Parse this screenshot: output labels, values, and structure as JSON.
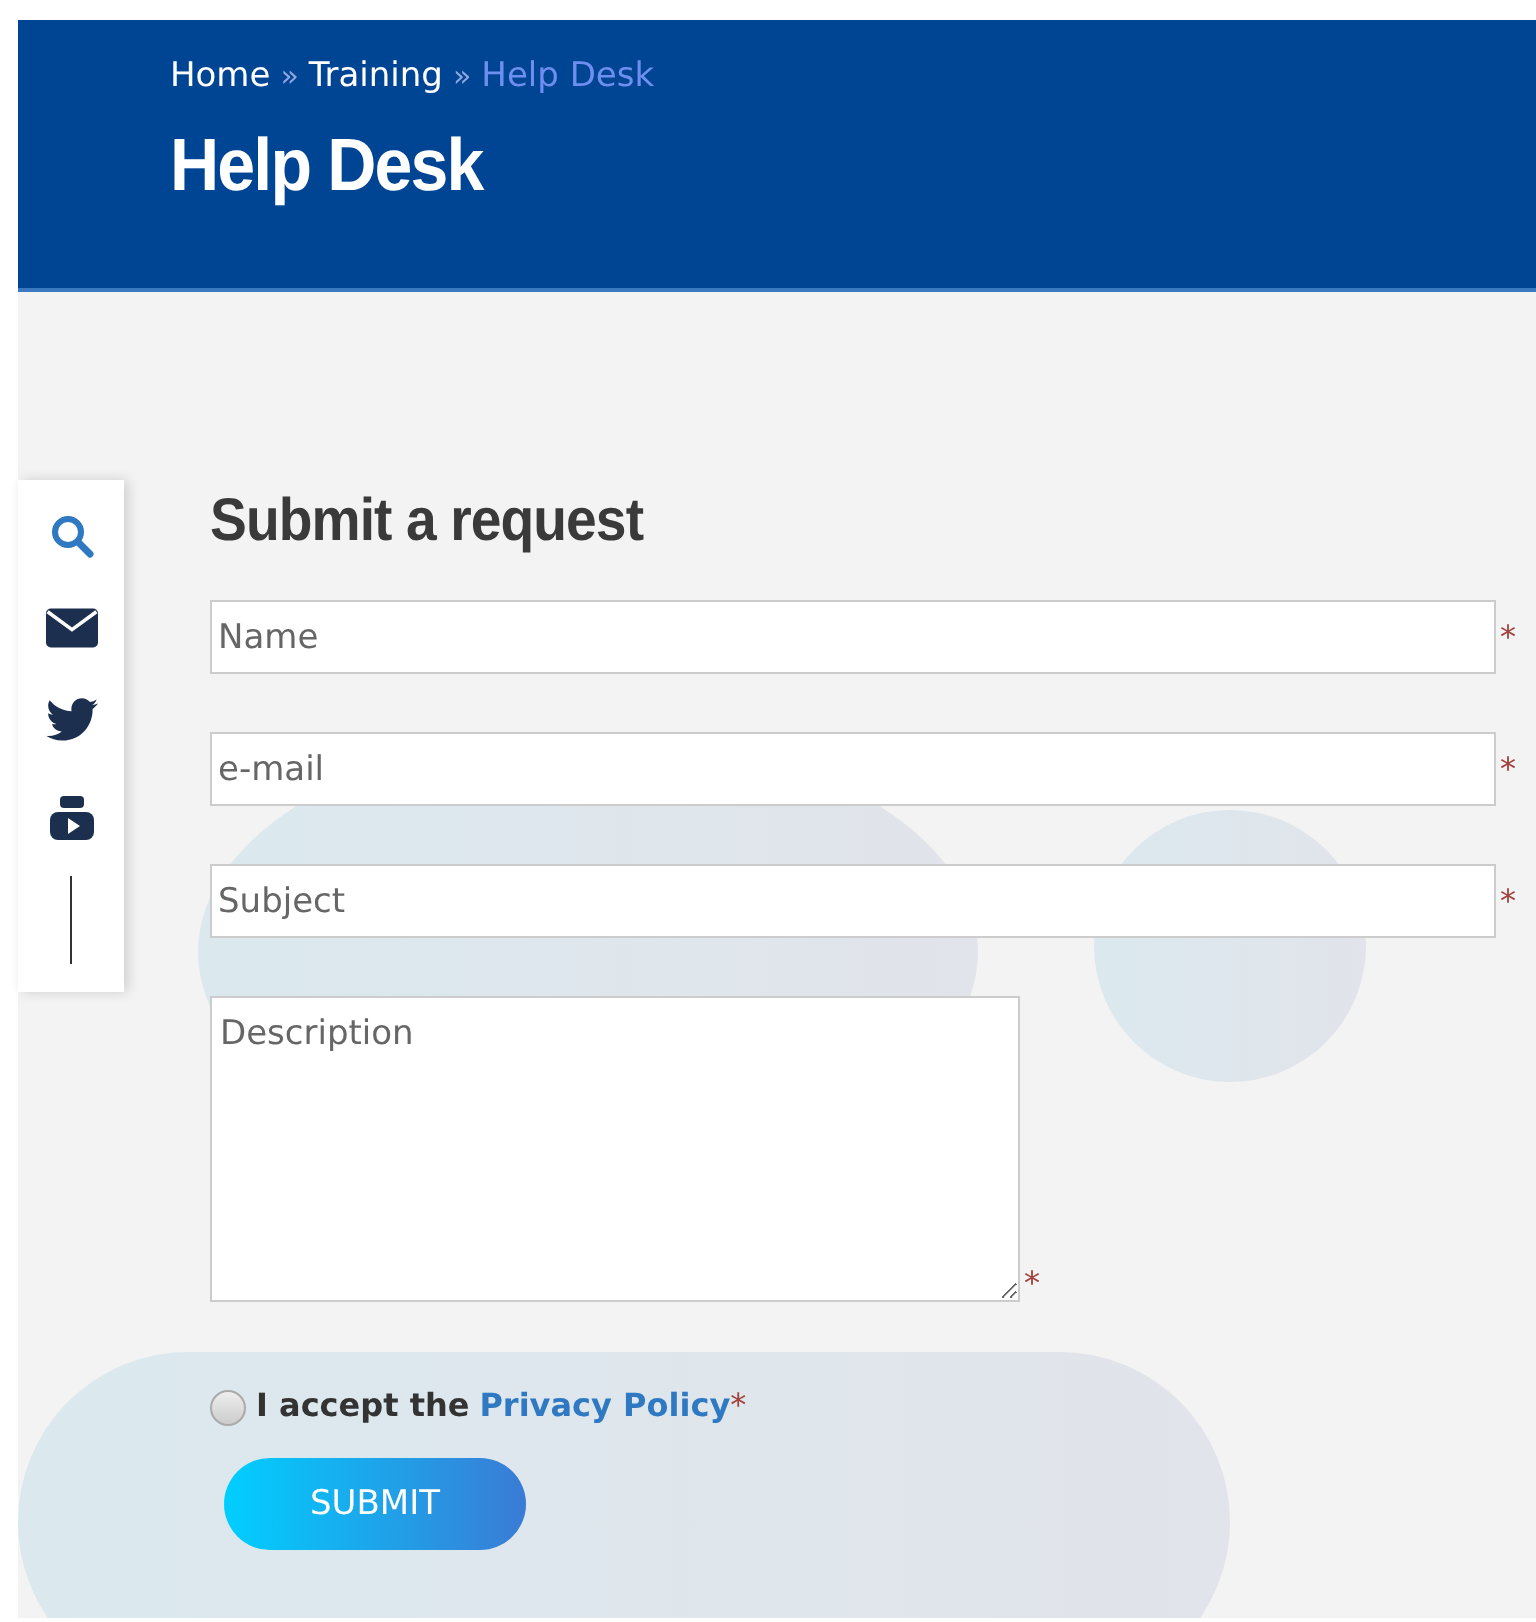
{
  "breadcrumb": [
    {
      "label": "Home",
      "current": false
    },
    {
      "label": "Training",
      "current": false
    },
    {
      "label": "Help Desk",
      "current": true
    }
  ],
  "breadcrumb_separator": "»",
  "page_title": "Help Desk",
  "social_sidebar": [
    {
      "kind": "search"
    },
    {
      "kind": "mail"
    },
    {
      "kind": "bird"
    },
    {
      "kind": "video"
    }
  ],
  "form": {
    "title": "Submit a request",
    "fields": [
      {
        "kind": "input",
        "placeholder": "Name",
        "required_mark": "*"
      },
      {
        "kind": "input",
        "placeholder": "e-mail",
        "required_mark": "*"
      },
      {
        "kind": "input",
        "placeholder": "Subject",
        "required_mark": "*"
      },
      {
        "kind": "textarea",
        "placeholder": "Description",
        "required_mark": "*"
      }
    ],
    "consent": {
      "checked": false,
      "text": "I accept the",
      "link": "Privacy Policy",
      "required_mark": "*"
    },
    "submit": "SUBMIT"
  }
}
